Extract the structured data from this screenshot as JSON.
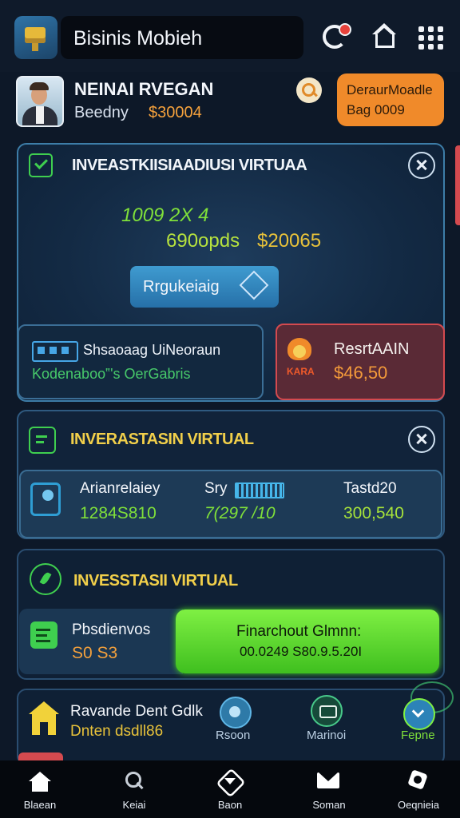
{
  "header": {
    "title": "Bisinis Mobieh",
    "icons": [
      "sync-alert-icon",
      "home-icon",
      "grid-menu-icon"
    ]
  },
  "profile": {
    "name": "NEINAI RVEGAN",
    "balance_label": "Beedny",
    "balance_value": "$30004",
    "action_line1": "DeraurMoadle",
    "action_line2": "Bag 0009"
  },
  "card1": {
    "title": "INVEASTKIISIAADIUSI VIRTUAA",
    "amount": "1009 2X 4",
    "units": "690opds",
    "price": "$20065",
    "register_label": "Rrgukeiaig",
    "sub_title": "Shsaoaag UiNeoraun",
    "sub_text": "Kodenaboo‟'s OerGabris",
    "red_tag": "KARA",
    "red_title": "ResrtAAIN",
    "red_value": "$46,50"
  },
  "card2": {
    "title": "INVERASTASIN VIRTUAL",
    "col1_label": "Arianrelaiey",
    "col1_value": "1284S810",
    "col2_label": "Sry",
    "col2_value": "7(297 /10",
    "col3_label": "Tastd20",
    "col3_value": "300,540"
  },
  "card3": {
    "title": "INVESSTASII VIRTUAL",
    "left_label": "Pbsdienvos",
    "left_value": "S0 S3",
    "button_line1": "Finarchout Glmnn:",
    "button_line2": "00.0249 S80.9.5.20I"
  },
  "card4": {
    "title": "Ravande Dent Gdlk",
    "subtitle": "Dnten dsdll86",
    "btn1_label": "Rsoon",
    "btn2_label": "Marinoi",
    "btn3_label": "Fepne"
  },
  "nav": [
    "Blaean",
    "Keiai",
    "Baon",
    "Soman",
    "Oeqnieia"
  ],
  "colors": {
    "accent_green": "#3fcf4f",
    "accent_orange": "#f08a2a",
    "accent_blue": "#2f74a8",
    "alert_red": "#d44a4f"
  }
}
